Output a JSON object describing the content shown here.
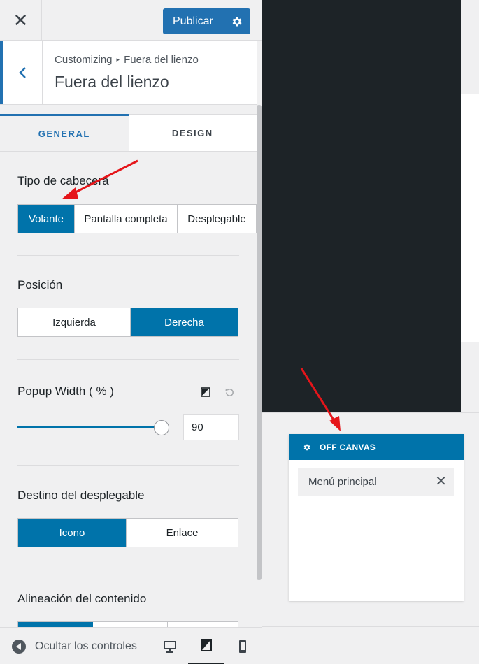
{
  "topbar": {
    "close_symbol": "✕",
    "publish_label": "Publicar"
  },
  "section": {
    "breadcrumb_root": "Customizing",
    "breadcrumb_sep": "▸",
    "breadcrumb_leaf": "Fuera del lienzo",
    "title": "Fuera del lienzo"
  },
  "tabs": [
    {
      "label": "General",
      "active": true
    },
    {
      "label": "Design",
      "active": false
    }
  ],
  "header_type": {
    "label": "Tipo de cabecera",
    "options": [
      "Volante",
      "Pantalla completa",
      "Desplegable"
    ],
    "selected": "Volante"
  },
  "position": {
    "label": "Posición",
    "options": [
      "Izquierda",
      "Derecha"
    ],
    "selected": "Derecha"
  },
  "popup_width": {
    "label": "Popup Width ( % )",
    "value": "90"
  },
  "dropdown_target": {
    "label": "Destino del desplegable",
    "options": [
      "Icono",
      "Enlace"
    ],
    "selected": "Icono"
  },
  "content_alignment": {
    "label": "Alineación del contenido"
  },
  "bottom": {
    "hide_controls_label": "Ocultar los controles",
    "devices": [
      "desktop",
      "tablet",
      "mobile"
    ],
    "active_device": "tablet"
  },
  "preview": {
    "panel_title": "OFF CANVAS",
    "menu_item": "Menú principal",
    "remove_symbol": "✕"
  },
  "colors": {
    "accent": "#0073aa",
    "publish": "#2271b1",
    "dark": "#1d2327",
    "annotation_arrow": "#e5151a"
  }
}
